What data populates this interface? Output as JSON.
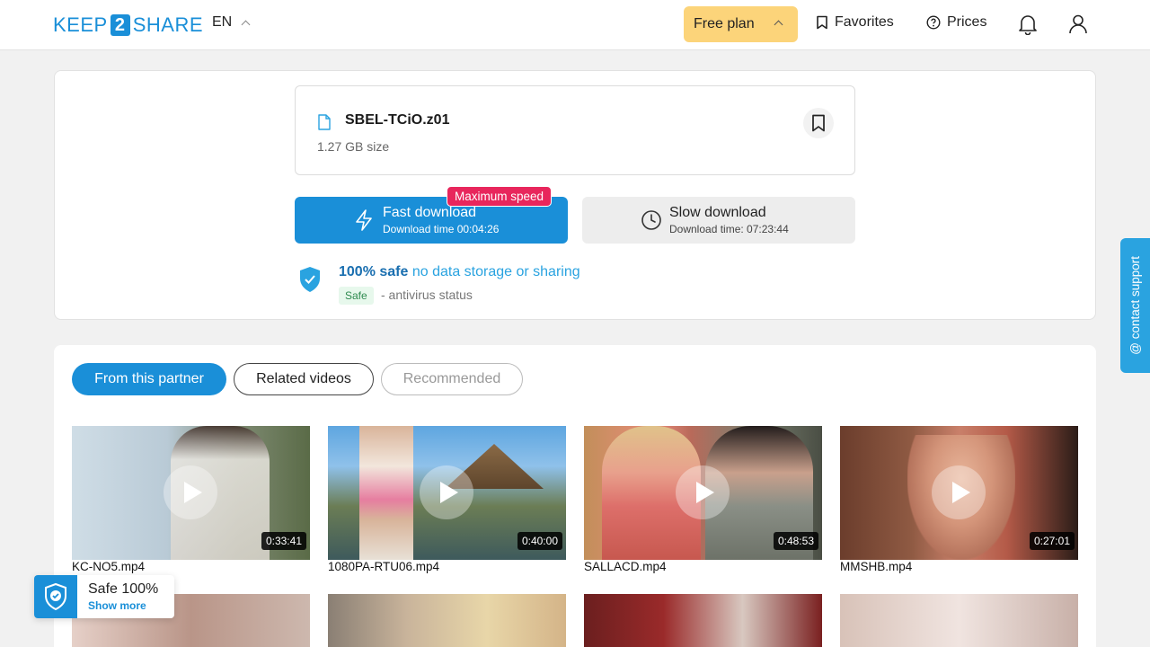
{
  "header": {
    "logo_left": "KEEP",
    "logo_mid": "2",
    "logo_right": "SHARE",
    "lang": "EN",
    "free_plan": "Free plan",
    "favorites": "Favorites",
    "prices": "Prices"
  },
  "file": {
    "name": "SBEL-TCiO.z01",
    "size": "1.27 GB size"
  },
  "download": {
    "fast_title": "Fast download",
    "fast_sub": "Download time 00:04:26",
    "max_speed": "Maximum speed",
    "slow_title": "Slow download",
    "slow_sub": "Download time: 07:23:44"
  },
  "safety": {
    "strong": "100% safe",
    "light": "no data storage or sharing",
    "badge": "Safe",
    "antivirus": "- antivirus status"
  },
  "tabs": [
    "From this partner",
    "Related videos",
    "Recommended"
  ],
  "videos": [
    {
      "name": "KC-NO5.mp4",
      "duration": "0:33:41"
    },
    {
      "name": "1080PA-RTU06.mp4",
      "duration": "0:40:00"
    },
    {
      "name": "SALLACD.mp4",
      "duration": "0:48:53"
    },
    {
      "name": "MMSHB.mp4",
      "duration": "0:27:01"
    }
  ],
  "support": "@ contact support",
  "safe_float": {
    "title": "Safe 100%",
    "link": "Show more"
  },
  "colors": {
    "brand": "#1a8fd8",
    "free_plan": "#fcd47a",
    "max_speed": "#e8265c"
  }
}
